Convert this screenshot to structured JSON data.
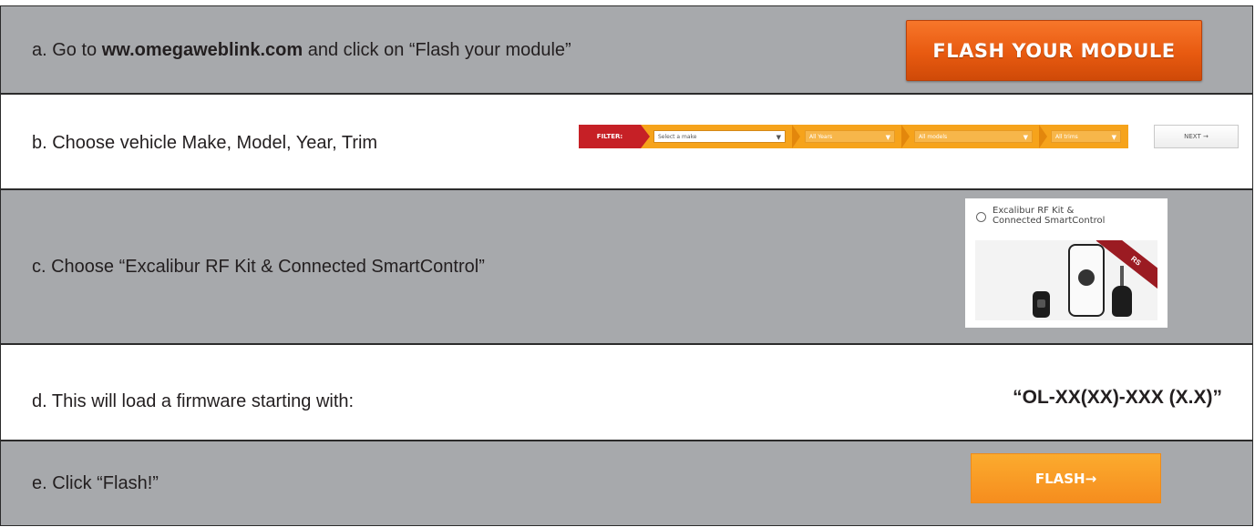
{
  "steps": {
    "a": {
      "prefix": "a. Go to ",
      "link": "ww.omegaweblink.com",
      "suffix": " and click on “Flash your module”",
      "button": "FLASH YOUR MODULE"
    },
    "b": {
      "text": "b. Choose vehicle Make, Model, Year, Trim",
      "filter_label": "FILTER:",
      "selects": [
        "Select a make",
        "All Years",
        "All models",
        "All trims"
      ],
      "next": "NEXT →"
    },
    "c": {
      "text": "c. Choose “Excalibur RF Kit & Connected SmartControl”",
      "option_line1": "Excalibur RF Kit &",
      "option_line2": "Connected SmartControl",
      "badge": "RS"
    },
    "d": {
      "text": "d. This will load a firmware starting with:",
      "firmware": "“OL-XX(XX)-XXX (X.X)”"
    },
    "e": {
      "text": "e. Click “Flash!”",
      "button": "FLASH→"
    }
  },
  "colors": {
    "gray_row": "#a7a9ac",
    "flash_module_orange": "#e85a10",
    "filter_orange": "#f6a31b",
    "filter_red": "#c62026"
  }
}
